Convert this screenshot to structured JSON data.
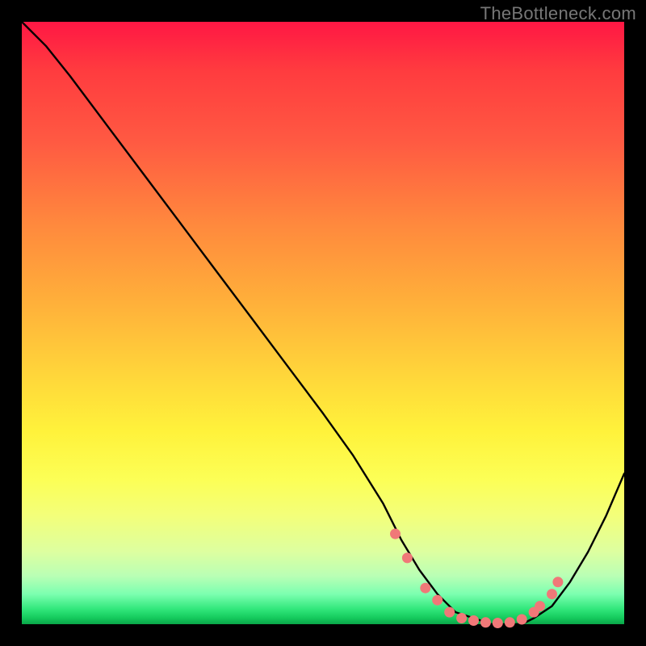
{
  "watermark": "TheBottleneck.com",
  "chart_data": {
    "type": "line",
    "title": "",
    "xlabel": "",
    "ylabel": "",
    "xlim": [
      0,
      100
    ],
    "ylim": [
      0,
      100
    ],
    "grid": false,
    "legend": false,
    "series": [
      {
        "name": "bottleneck-curve",
        "x": [
          0,
          4,
          8,
          14,
          20,
          26,
          32,
          38,
          44,
          50,
          55,
          60,
          63,
          66,
          69,
          72,
          75,
          78,
          81,
          83,
          85,
          88,
          91,
          94,
          97,
          100
        ],
        "y": [
          100,
          96,
          91,
          83,
          75,
          67,
          59,
          51,
          43,
          35,
          28,
          20,
          14,
          9,
          5,
          2,
          1,
          0,
          0,
          0,
          1,
          3,
          7,
          12,
          18,
          25
        ]
      }
    ],
    "highlight_points": {
      "name": "sweet-spot-dots",
      "x": [
        62,
        64,
        67,
        69,
        71,
        73,
        75,
        77,
        79,
        81,
        83,
        85,
        86,
        88,
        89
      ],
      "y": [
        15,
        11,
        6,
        4,
        2,
        1,
        0.6,
        0.3,
        0.2,
        0.3,
        0.8,
        2,
        3,
        5,
        7
      ]
    }
  }
}
